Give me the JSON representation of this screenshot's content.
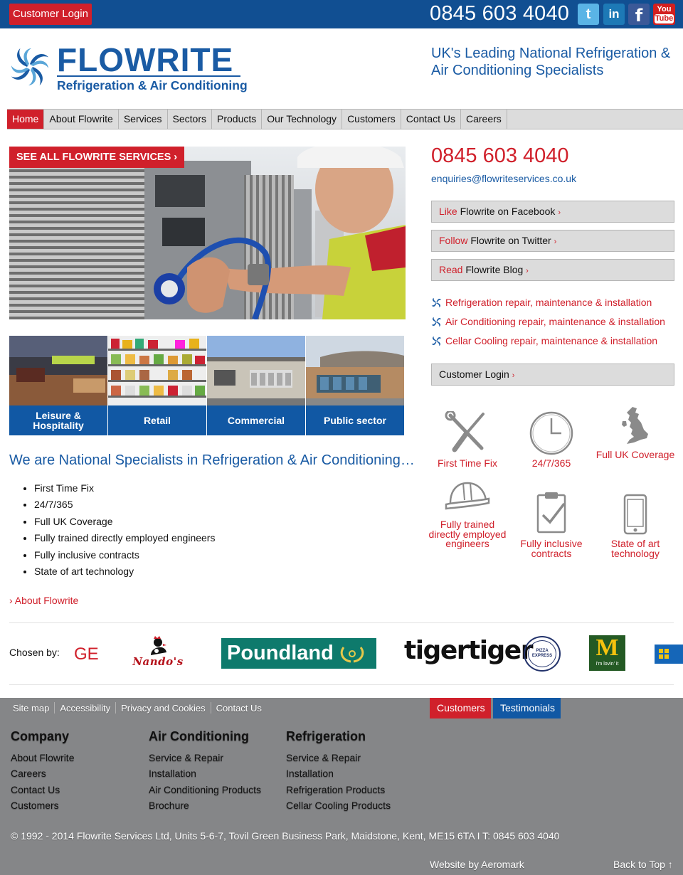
{
  "topbar": {
    "login_label": "Customer Login",
    "phone": "0845 603 4040",
    "social": {
      "twitter": "t",
      "linkedin": "in",
      "facebook": "f",
      "youtube_top": "You",
      "youtube_bottom": "Tube"
    }
  },
  "header": {
    "brand_name": "FLOWRITE",
    "brand_sub": "Refrigeration & Air Conditioning",
    "tagline": "UK's Leading National Refrigeration & Air Conditioning Specialists"
  },
  "nav": {
    "items": [
      "Home",
      "About Flowrite",
      "Services",
      "Sectors",
      "Products",
      "Our Technology",
      "Customers",
      "Contact Us",
      "Careers"
    ]
  },
  "hero": {
    "button_label": "SEE ALL FLOWRITE SERVICES ›"
  },
  "sectors": [
    "Leisure & Hospitality",
    "Retail",
    "Commercial",
    "Public sector"
  ],
  "intro": {
    "heading": "We are National Specialists in Refrigeration & Air Conditioning…",
    "bullets": [
      "First Time Fix",
      "24/7/365",
      "Full UK Coverage",
      "Fully trained directly employed engineers",
      "Fully inclusive contracts",
      "State of art technology"
    ],
    "about_link": "› About Flowrite"
  },
  "sidebar": {
    "phone": "0845 603 4040",
    "email": "enquiries@flowriteservices.co.uk",
    "social_buttons": [
      {
        "verb": "Like",
        "rest": " Flowrite on Facebook ",
        "arrow": "›"
      },
      {
        "verb": "Follow",
        "rest": " Flowrite on Twitter ",
        "arrow": "›"
      },
      {
        "verb": "Read",
        "rest": " Flowrite Blog ",
        "arrow": "›"
      }
    ],
    "services": [
      "Refrigeration repair, maintenance & installation",
      "Air Conditioning repair, maintenance & installation",
      "Cellar Cooling repair, maintenance & installation"
    ],
    "login_label": "Customer Login ",
    "login_arrow": "›",
    "features": [
      "First Time Fix",
      "24/7/365",
      "Full UK Coverage",
      "Fully trained directly employed engineers",
      "Fully inclusive contracts",
      "State of art technology"
    ]
  },
  "clients": {
    "label": "Chosen by:",
    "logos": [
      "GE",
      "Nando's",
      "Poundland",
      "tigertiger",
      "PIZZA EXPRESS",
      "i'm lovin' it"
    ]
  },
  "footer": {
    "util_links": [
      "Site map",
      "Accessibility",
      "Privacy and Cookies",
      "Contact Us"
    ],
    "tabs": [
      "Customers",
      "Testimonials"
    ],
    "columns": [
      {
        "heading": "Company",
        "links": [
          "About Flowrite",
          "Careers",
          "Contact Us",
          "Customers"
        ]
      },
      {
        "heading": "Air Conditioning",
        "links": [
          "Service & Repair",
          "Installation",
          "Air Conditioning Products",
          "Brochure"
        ]
      },
      {
        "heading": "Refrigeration",
        "links": [
          "Service & Repair",
          "Installation",
          "Refrigeration Products",
          "Cellar Cooling Products"
        ]
      }
    ],
    "copyright": "© 1992 - 2014 Flowrite Services Ltd, Units 5-6-7, Tovil Green Business Park, Maidstone, Kent, ME15 6TA I T: 0845 603 4040",
    "credit": "Website by Aeromark",
    "back_to_top": "Back to Top ↑"
  },
  "colors": {
    "brand_blue": "#114f92",
    "accent_red": "#d0202b",
    "nav_grey": "#dcdcdc",
    "footer_grey": "#858688"
  }
}
